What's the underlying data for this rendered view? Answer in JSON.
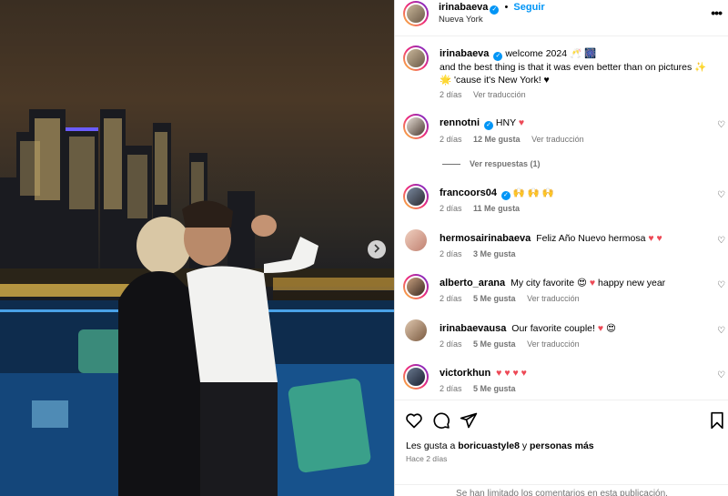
{
  "post": {
    "author": "irinabaeva",
    "follow_label": "Seguir",
    "dot": "•",
    "location": "Nueva York",
    "more_label": "•••"
  },
  "caption": {
    "user": "irinabaeva",
    "text_line1": "welcome 2024 🥂 🎆",
    "text_line2": "and the best thing is that it was even better than on pictures ✨",
    "text_line3": "🌟 'cause it's New York! ♥",
    "time": "2 días",
    "translate": "Ver traducción"
  },
  "comments": [
    {
      "user": "rennotni",
      "verified": true,
      "text": "HNY ❤️",
      "time": "2 días",
      "likes": "12 Me gusta",
      "translate": "Ver traducción",
      "replies": "Ver respuestas (1)"
    },
    {
      "user": "francoors04",
      "verified": true,
      "text": "🙌 🙌 🙌",
      "time": "2 días",
      "likes": "11 Me gusta",
      "translate": ""
    },
    {
      "user": "hermosairinabaeva",
      "verified": false,
      "text": "Feliz Año Nuevo hermosa ❤️ ❤️",
      "time": "2 días",
      "likes": "3 Me gusta",
      "translate": ""
    },
    {
      "user": "alberto_arana",
      "verified": false,
      "text": "My city favorite 😍 ❤️ happy new year",
      "time": "2 días",
      "likes": "5 Me gusta",
      "translate": "Ver traducción"
    },
    {
      "user": "irinabaevausa",
      "verified": false,
      "text": "Our favorite couple! ❤️ 😍",
      "time": "2 días",
      "likes": "5 Me gusta",
      "translate": "Ver traducción"
    },
    {
      "user": "victorkhun",
      "verified": false,
      "text": "❤️ ❤️ ❤️ ❤️",
      "time": "2 días",
      "likes": "5 Me gusta",
      "translate": ""
    }
  ],
  "footer": {
    "likes_prefix": "Les gusta a",
    "likes_user": "boricuastyle8",
    "likes_mid": "y",
    "likes_others": "personas más",
    "posted": "Hace 2 días",
    "limited": "Se han limitado los comentarios en esta publicación."
  },
  "colors": {
    "accent": "#0095f6",
    "like_red": "#ed4956",
    "muted": "#737373"
  },
  "icons": [
    "heart-icon",
    "comment-icon",
    "share-icon",
    "bookmark-icon",
    "verified-icon",
    "chevron-right-icon",
    "more-icon"
  ]
}
